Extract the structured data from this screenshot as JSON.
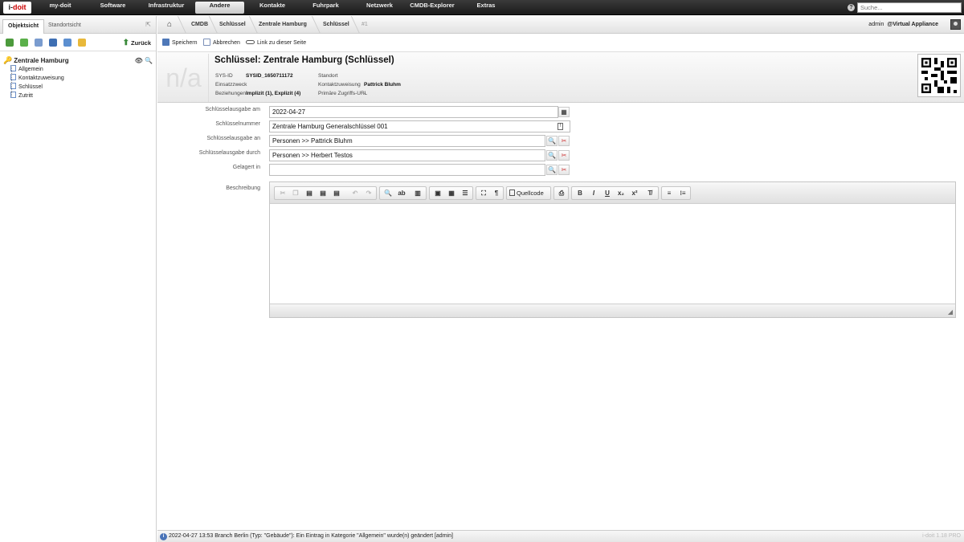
{
  "app": {
    "logo": "i-doit",
    "version": "i-doit 1.18 PRO"
  },
  "nav": {
    "items": [
      "my-doit",
      "Software",
      "Infrastruktur",
      "Andere",
      "Kontakte",
      "Fuhrpark",
      "Netzwerk",
      "CMDB-Explorer",
      "Extras"
    ],
    "active": "Andere"
  },
  "search": {
    "placeholder": "Suche..."
  },
  "left": {
    "tabs": [
      "Objektsicht",
      "Standortsicht"
    ],
    "back_label": "Zurück",
    "tree": {
      "root": "Zentrale Hamburg",
      "items": [
        "Allgemein",
        "Kontaktzuweisung",
        "Schlüssel",
        "Zutritt"
      ]
    }
  },
  "breadcrumb": [
    "CMDB",
    "Schlüssel",
    "Zentrale Hamburg",
    "Schlüssel",
    "#1"
  ],
  "user": {
    "name": "admin",
    "tenant": "@Virtual Appliance"
  },
  "actions": {
    "save": "Speichern",
    "cancel": "Abbrechen",
    "link": "Link zu dieser Seite"
  },
  "header": {
    "placeholder": "n/a",
    "title": "Schlüssel: Zentrale Hamburg (Schlüssel)",
    "sysid_label": "SYS-ID",
    "sysid": "SYSID_1650711172",
    "purpose_label": "Einsatzzweck",
    "relations_label": "Beziehungen",
    "relations": "Implizit (1), Explizit (4)",
    "location_label": "Standort",
    "contact_label": "Kontaktzuweisung",
    "contact": "Pattrick Bluhm",
    "url_label": "Primäre Zugriffs-URL",
    "url": "-"
  },
  "form": {
    "issue_date_label": "Schlüsselausgabe am",
    "issue_date": "2022-04-27",
    "key_number_label": "Schlüsselnummer",
    "key_number": "Zentrale Hamburg Generalschlüssel 001",
    "issued_to_label": "Schlüsselausgabe an",
    "issued_to": "Personen >> Pattrick Bluhm",
    "issued_by_label": "Schlüsselausgabe durch",
    "issued_by": "Personen >> Herbert Testos",
    "stored_in_label": "Gelagert in",
    "stored_in": "",
    "description_label": "Beschreibung"
  },
  "editor": {
    "source_label": "Quellcode",
    "bold": "B",
    "italic": "I",
    "underline": "U"
  },
  "status": {
    "text": "2022-04-27 13:53 Branch Berlin (Typ: \"Gebäude\"): Ein Eintrag in Kategorie \"Allgemein\" wurde(n) geändert [admin]"
  }
}
